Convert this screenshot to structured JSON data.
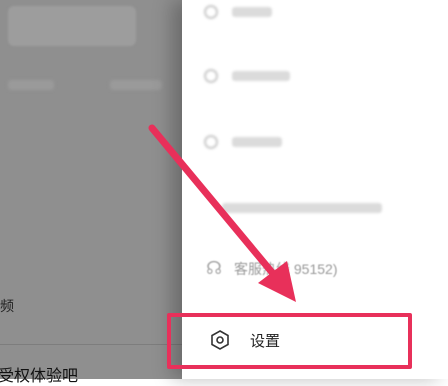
{
  "background_app": {
    "video_label": "频",
    "trial_text": "受权体验吧"
  },
  "drawer": {
    "blurred_items": [
      "",
      "",
      "",
      ""
    ],
    "customer_service_label": "客服热线 95152)",
    "settings_label": "设置"
  },
  "annotation": {
    "highlight_color": "#e8305a"
  },
  "icons": {
    "settings": "hexagon-gear-icon",
    "customer_service": "headset-icon"
  }
}
